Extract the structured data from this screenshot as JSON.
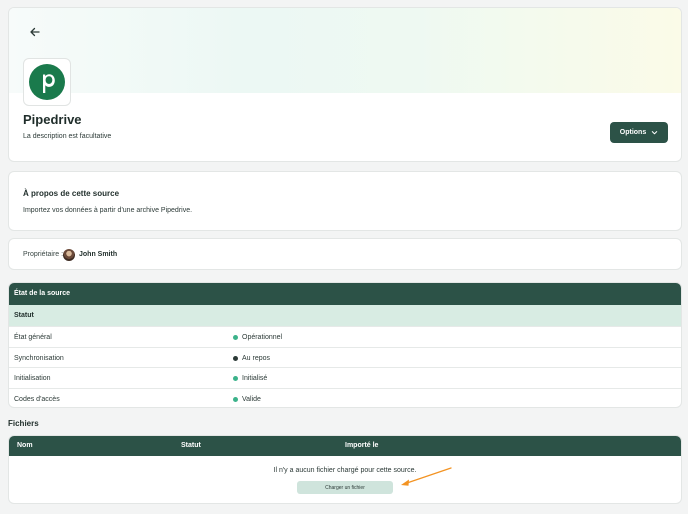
{
  "source": {
    "name": "Pipedrive",
    "description": "La description est facultative",
    "options_label": "Options"
  },
  "about": {
    "title": "À propos de cette source",
    "text": "Importez vos données à partir d'une archive Pipedrive."
  },
  "owner": {
    "label": "Propriétaire :",
    "name": "John Smith"
  },
  "status_table": {
    "title": "État de la source",
    "subheader": "Statut",
    "rows": [
      {
        "key": "État général",
        "value": "Opérationnel",
        "color": "#3bb28a"
      },
      {
        "key": "Synchronisation",
        "value": "Au repos",
        "color": "#2c3a37"
      },
      {
        "key": "Initialisation",
        "value": "Initialisé",
        "color": "#3bb28a"
      },
      {
        "key": "Codes d'accès",
        "value": "Valide",
        "color": "#3bb28a"
      }
    ]
  },
  "files": {
    "title": "Fichiers",
    "columns": [
      "Nom",
      "Statut",
      "Importé le"
    ],
    "empty_text": "Il n'y a aucun fichier chargé pour cette source.",
    "upload_label": "Charger un fichier"
  },
  "colors": {
    "primary": "#2c5247",
    "accent_light": "#d8ece3",
    "pipedrive_green": "#1a7a4c",
    "annotation_orange": "#f39322"
  },
  "icons": {
    "back": "arrow-left-icon",
    "options": "chevron-down-icon",
    "logo": "pipedrive-logo"
  }
}
